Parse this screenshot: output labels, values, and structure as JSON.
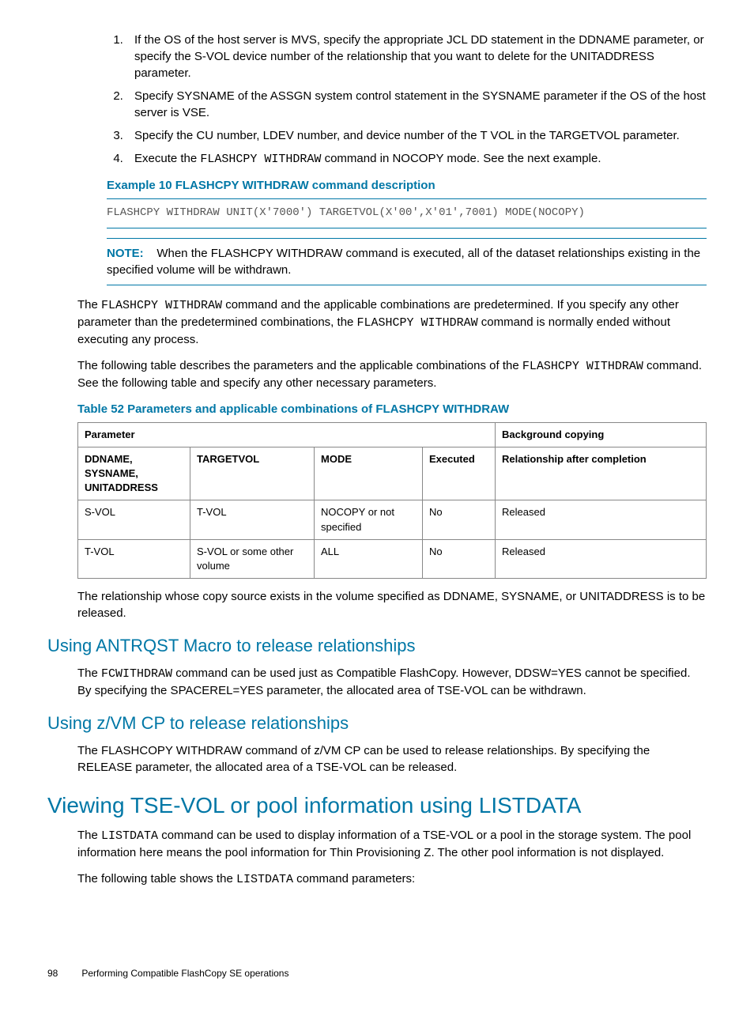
{
  "list": {
    "i1": "If the OS of the host server is MVS, specify the appropriate JCL DD statement in the DDNAME parameter, or specify the S-VOL device number of the relationship that you want to delete for the UNITADDRESS parameter.",
    "i2": "Specify SYSNAME of the ASSGN system control statement in the SYSNAME parameter if the OS of the host server is VSE.",
    "i3": "Specify the CU number, LDEV number, and device number of the T VOL in the TARGETVOL parameter.",
    "i4a": "Execute the ",
    "i4code": "FLASHCPY WITHDRAW",
    "i4b": " command in NOCOPY mode. See the next example."
  },
  "example": {
    "title": "Example 10 FLASHCPY WITHDRAW command description",
    "code": "FLASHCPY WITHDRAW UNIT(X'7000') TARGETVOL(X'00',X'01',7001) MODE(NOCOPY)"
  },
  "note": {
    "label": "NOTE:",
    "text": "When the FLASHCPY WITHDRAW command is executed, all of the dataset relationships existing in the specified volume will be withdrawn."
  },
  "para1": {
    "a": "The ",
    "c1": "FLASHCPY WITHDRAW",
    "b": " command and the applicable combinations are predetermined. If you specify any other parameter than the predetermined combinations, the ",
    "c2": "FLASHCPY WITHDRAW",
    "c": " command is normally ended without executing any process."
  },
  "para2": {
    "a": "The following table describes the parameters and the applicable combinations of the ",
    "c1": "FLASHCPY WITHDRAW",
    "b": " command. See the following table and specify any other necessary parameters."
  },
  "table": {
    "title": "Table 52 Parameters and applicable combinations of FLASHCPY WITHDRAW",
    "h_param": "Parameter",
    "h_bg": "Background copying",
    "h_dd": "DDNAME, SYSNAME, UNITADDRESS",
    "h_tgt": "TARGETVOL",
    "h_mode": "MODE",
    "h_exec": "Executed",
    "h_rel": "Relationship after completion",
    "r1": {
      "c1": "S-VOL",
      "c2": "T-VOL",
      "c3": "NOCOPY or not specified",
      "c4": "No",
      "c5": "Released"
    },
    "r2": {
      "c1": "T-VOL",
      "c2": "S-VOL or some other volume",
      "c3": "ALL",
      "c4": "No",
      "c5": "Released"
    }
  },
  "para3": "The relationship whose copy source exists in the volume specified as DDNAME, SYSNAME, or UNITADDRESS is to be released.",
  "h_antrqst": "Using ANTRQST Macro to release relationships",
  "para4": {
    "a": "The ",
    "c1": "FCWITHDRAW",
    "b": " command can be used just as Compatible FlashCopy. However, DDSW=YES cannot be specified. By specifying the SPACEREL=YES parameter, the allocated area of TSE-VOL can be withdrawn."
  },
  "h_zvm": "Using z/VM CP to release relationships",
  "para5": "The FLASHCOPY WITHDRAW command of z/VM CP can be used to release relationships. By specifying the RELEASE parameter, the allocated area of a TSE-VOL can be released.",
  "h_view": "Viewing TSE-VOL or pool information using LISTDATA",
  "para6": {
    "a": "The ",
    "c1": "LISTDATA",
    "b": " command can be used to display information of a TSE-VOL or a pool in the storage system. The pool information here means the pool information for Thin Provisioning Z. The other pool information is not displayed."
  },
  "para7": {
    "a": "The following table shows the ",
    "c1": "LISTDATA",
    "b": " command parameters:"
  },
  "footer": {
    "page": "98",
    "chapter": "Performing Compatible FlashCopy SE operations"
  }
}
